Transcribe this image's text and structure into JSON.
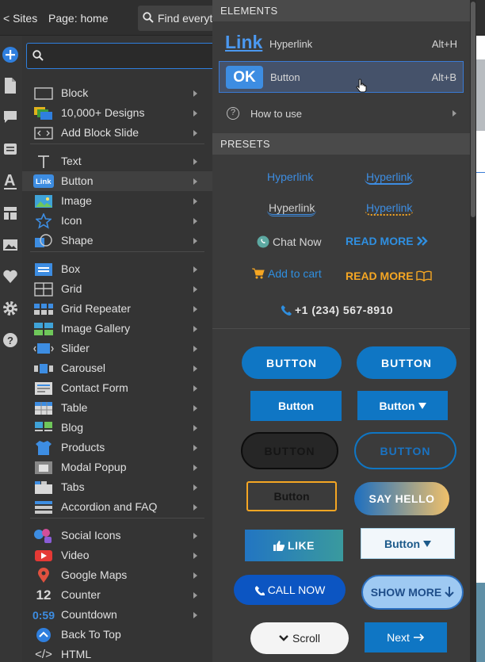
{
  "topbar": {
    "sites": "< Sites",
    "page": "Page: home",
    "find": "Find everyt"
  },
  "search": {
    "placeholder": ""
  },
  "left_items": [
    {
      "label": "Block",
      "icon": "block-icon"
    },
    {
      "label": "10,000+ Designs",
      "icon": "designs-icon"
    },
    {
      "label": "Add Block Slide",
      "icon": "block-slide-icon"
    },
    {
      "label": "Text",
      "icon": "text-icon"
    },
    {
      "label": "Button",
      "icon": "button-icon"
    },
    {
      "label": "Image",
      "icon": "image-icon"
    },
    {
      "label": "Icon",
      "icon": "star-icon"
    },
    {
      "label": "Shape",
      "icon": "shape-icon"
    },
    {
      "label": "Box",
      "icon": "box-icon"
    },
    {
      "label": "Grid",
      "icon": "grid-icon"
    },
    {
      "label": "Grid Repeater",
      "icon": "grid-repeater-icon"
    },
    {
      "label": "Image Gallery",
      "icon": "gallery-icon"
    },
    {
      "label": "Slider",
      "icon": "slider-icon"
    },
    {
      "label": "Carousel",
      "icon": "carousel-icon"
    },
    {
      "label": "Contact Form",
      "icon": "contact-form-icon"
    },
    {
      "label": "Table",
      "icon": "table-icon"
    },
    {
      "label": "Blog",
      "icon": "blog-icon"
    },
    {
      "label": "Products",
      "icon": "products-icon"
    },
    {
      "label": "Modal Popup",
      "icon": "modal-icon"
    },
    {
      "label": "Tabs",
      "icon": "tabs-icon"
    },
    {
      "label": "Accordion and FAQ",
      "icon": "accordion-icon"
    },
    {
      "label": "Social Icons",
      "icon": "social-icon"
    },
    {
      "label": "Video",
      "icon": "video-icon"
    },
    {
      "label": "Google Maps",
      "icon": "map-pin-icon"
    },
    {
      "label": "Counter",
      "icon": "counter-icon",
      "glyph": "12"
    },
    {
      "label": "Countdown",
      "icon": "countdown-icon",
      "glyph": "0:59"
    },
    {
      "label": "Back To Top",
      "icon": "back-to-top-icon"
    },
    {
      "label": "HTML",
      "icon": "code-icon",
      "glyph": "</>"
    }
  ],
  "button_icon_text": "Link",
  "elements": {
    "header": "ELEMENTS",
    "link_glyph": "Link",
    "hyperlink_label": "Hyperlink",
    "hyperlink_key": "Alt+H",
    "ok_glyph": "OK",
    "button_label": "Button",
    "button_key": "Alt+B",
    "howto_label": "How to use"
  },
  "presets": {
    "header": "PRESETS",
    "hl1": "Hyperlink",
    "hl2": "Hyperlink",
    "hl3": "Hyperlink",
    "hl4": "Hyperlink",
    "chat": "Chat Now",
    "readmore1": "READ MORE",
    "cart": "Add to cart",
    "readmore2": "READ MORE",
    "phone": "+1 (234) 567-8910"
  },
  "buttons": {
    "b1": "BUTTON",
    "b2": "BUTTON",
    "b3": "Button",
    "b4": "Button",
    "b5": "BUTTON",
    "b6": "BUTTON",
    "b7": "Button",
    "b8": "SAY HELLO",
    "b9": "LIKE",
    "b10": "Button",
    "b11": "CALL NOW",
    "b12": "SHOW MORE",
    "b13": "Scroll",
    "b14": "Next"
  },
  "colors": {
    "accent": "#2f7fde",
    "button_blue": "#0f76c4",
    "orange": "#f5a623"
  }
}
